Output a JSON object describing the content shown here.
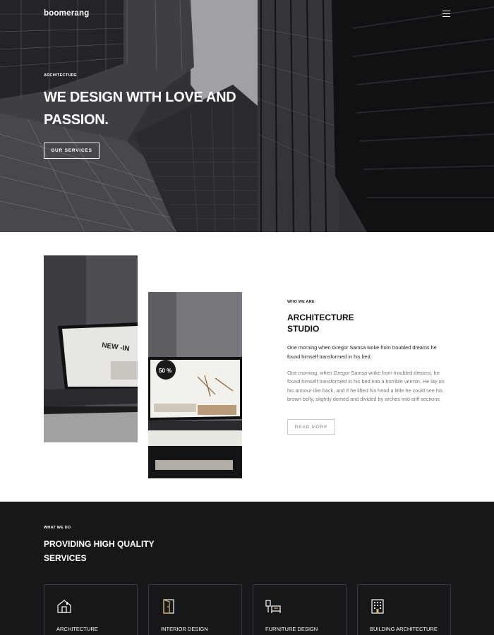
{
  "header": {
    "logo": "boomerang",
    "menu_icon": "hamburger-icon"
  },
  "hero": {
    "eyebrow": "ARCHITECTURE",
    "title": "WE DESIGN WITH LOVE AND PASSION.",
    "button_label": "OUR SERVICES"
  },
  "about": {
    "eyebrow": "WHO WE ARE",
    "title_line1": "ARCHITECTURE",
    "title_line2": "STUDIO",
    "lead": "One morning when Gregor Samsa woke from troubled dreams he found himself transformed in his bed.",
    "body": "One morning, when Gregor Samsa woke from troubled dreams, he found himself transformed in his bed into a horrible vermin. He lay on his armour-like back, and if he lifted his head a little he could see his brown belly, slightly domed and divided by arches into stiff sections.",
    "button_label": "READ MORE",
    "image1_text": "NEW -IN",
    "image2_text": "50 %"
  },
  "services": {
    "eyebrow": "WHAT WE DO",
    "title_line1": "PROVIDING HIGH QUALITY",
    "title_line2": "SERVICES",
    "cards": [
      {
        "label": "ARCHITECTURE",
        "icon": "house-icon"
      },
      {
        "label": "INTERIOR DESIGN",
        "icon": "door-icon"
      },
      {
        "label": "FURNITURE DESIGN",
        "icon": "furniture-icon"
      },
      {
        "label": "BUILDING ARCHITECTURE",
        "icon": "building-icon"
      }
    ]
  },
  "colors": {
    "hero_bg": "#2e2e32",
    "dark_section": "#17171a",
    "text_dark": "#111111",
    "text_muted": "#777777",
    "accent_gold": "#d9b86a"
  }
}
